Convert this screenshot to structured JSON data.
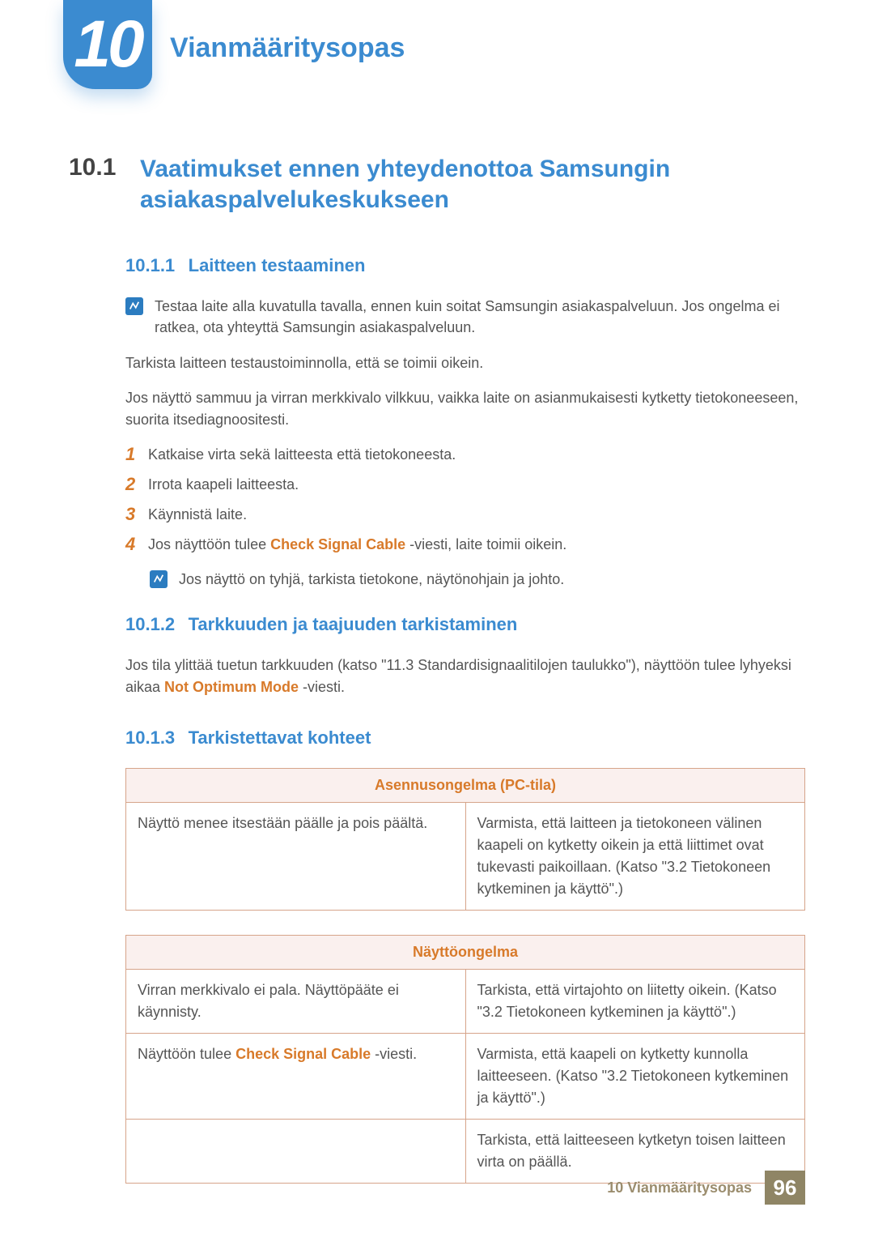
{
  "chapter": {
    "number": "10",
    "title": "Vianmääritysopas"
  },
  "section": {
    "num": "10.1",
    "title": "Vaatimukset ennen yhteydenottoa Samsungin asiakaspalvelukeskukseen"
  },
  "sub1": {
    "num": "10.1.1",
    "title": "Laitteen testaaminen",
    "note": "Testaa laite alla kuvatulla tavalla, ennen kuin soitat Samsungin asiakaspalveluun. Jos ongelma ei ratkea, ota yhteyttä Samsungin asiakaspalveluun.",
    "p1": "Tarkista laitteen testaustoiminnolla, että se toimii oikein.",
    "p2": "Jos näyttö sammuu ja virran merkkivalo vilkkuu, vaikka laite on asianmukaisesti kytketty tietokoneeseen, suorita itsediagnoositesti.",
    "steps": [
      "Katkaise virta sekä laitteesta että tietokoneesta.",
      "Irrota kaapeli laitteesta.",
      "Käynnistä laite."
    ],
    "step4_pre": "Jos näyttöön tulee ",
    "step4_highlight": "Check Signal Cable",
    "step4_post": " -viesti, laite toimii oikein.",
    "note2": "Jos näyttö on tyhjä, tarkista tietokone, näytönohjain ja johto."
  },
  "sub2": {
    "num": "10.1.2",
    "title": "Tarkkuuden ja taajuuden tarkistaminen",
    "p_pre": "Jos tila ylittää tuetun tarkkuuden (katso \"11.3 Standardisignaalitilojen taulukko\"), näyttöön tulee lyhyeksi aikaa ",
    "p_highlight": "Not Optimum Mode",
    "p_post": " -viesti."
  },
  "sub3": {
    "num": "10.1.3",
    "title": "Tarkistettavat kohteet",
    "table1": {
      "header": "Asennusongelma (PC-tila)",
      "rows": [
        {
          "left": "Näyttö menee itsestään päälle ja pois päältä.",
          "right": "Varmista, että laitteen ja tietokoneen välinen kaapeli on kytketty oikein ja että liittimet ovat tukevasti paikoillaan. (Katso \"3.2 Tietokoneen kytkeminen ja käyttö\".)"
        }
      ]
    },
    "table2": {
      "header": "Näyttöongelma",
      "rows": [
        {
          "left": "Virran merkkivalo ei pala. Näyttöpääte ei käynnisty.",
          "right": "Tarkista, että virtajohto on liitetty oikein. (Katso \"3.2 Tietokoneen kytkeminen ja käyttö\".)"
        },
        {
          "left_pre": "Näyttöön tulee ",
          "left_hl": "Check Signal Cable",
          "left_post": " -viesti.",
          "right": "Varmista, että kaapeli on kytketty kunnolla laitteeseen. (Katso \"3.2 Tietokoneen kytkeminen ja käyttö\".)"
        },
        {
          "left": "",
          "right": "Tarkista, että laitteeseen kytketyn toisen laitteen virta on päällä."
        }
      ]
    }
  },
  "footer": {
    "text": "10 Vianmääritysopas",
    "page": "96"
  }
}
